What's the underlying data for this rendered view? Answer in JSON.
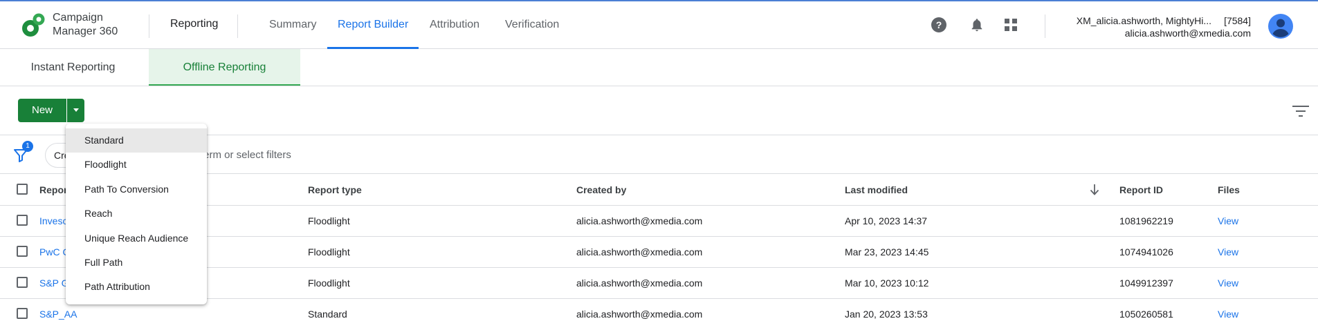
{
  "header": {
    "product_line1": "Campaign",
    "product_line2": "Manager 360",
    "section": "Reporting",
    "nav_tabs": [
      "Summary",
      "Report Builder",
      "Attribution",
      "Verification"
    ],
    "active_tab": "Report Builder",
    "icons": [
      "help-icon",
      "notifications-bell-icon",
      "apps-grid-icon"
    ],
    "account_name": "XM_alicia.ashworth, MightyHi...",
    "account_id": "[7584]",
    "account_email": "alicia.ashworth@xmedia.com"
  },
  "subtabs": [
    "Instant Reporting",
    "Offline Reporting"
  ],
  "active_subtab": "Offline Reporting",
  "toolbar": {
    "new_label": "New"
  },
  "filterbar": {
    "filter_count": "1",
    "chip_label": "Cre",
    "search_placeholder": "term or select filters"
  },
  "table": {
    "headers": {
      "name": "Report",
      "type": "Report type",
      "created_by": "Created by",
      "last_modified": "Last modified",
      "report_id": "Report ID",
      "files": "Files"
    },
    "rows": [
      {
        "name": "Invesc",
        "type": "Floodlight",
        "created_by": "alicia.ashworth@xmedia.com",
        "last_modified": "Apr 10, 2023 14:37",
        "report_id": "1081962219",
        "files": "View"
      },
      {
        "name": "PwC C",
        "type": "Floodlight",
        "created_by": "alicia.ashworth@xmedia.com",
        "last_modified": "Mar 23, 2023 14:45",
        "report_id": "1074941026",
        "files": "View"
      },
      {
        "name": "S&P G",
        "type": "Floodlight",
        "created_by": "alicia.ashworth@xmedia.com",
        "last_modified": "Mar 10, 2023 10:12",
        "report_id": "1049912397",
        "files": "View"
      },
      {
        "name": "S&P_AA",
        "type": "Standard",
        "created_by": "alicia.ashworth@xmedia.com",
        "last_modified": "Jan 20, 2023 13:53",
        "report_id": "1050260581",
        "files": "View"
      }
    ]
  },
  "dropdown": {
    "items": [
      "Standard",
      "Floodlight",
      "Path To Conversion",
      "Reach",
      "Unique Reach Audience",
      "Full Path",
      "Path Attribution"
    ],
    "highlighted": "Standard"
  },
  "colors": {
    "brand_green": "#188038",
    "accent_blue": "#1a73e8",
    "active_subtab_bg": "#e6f4ea"
  }
}
